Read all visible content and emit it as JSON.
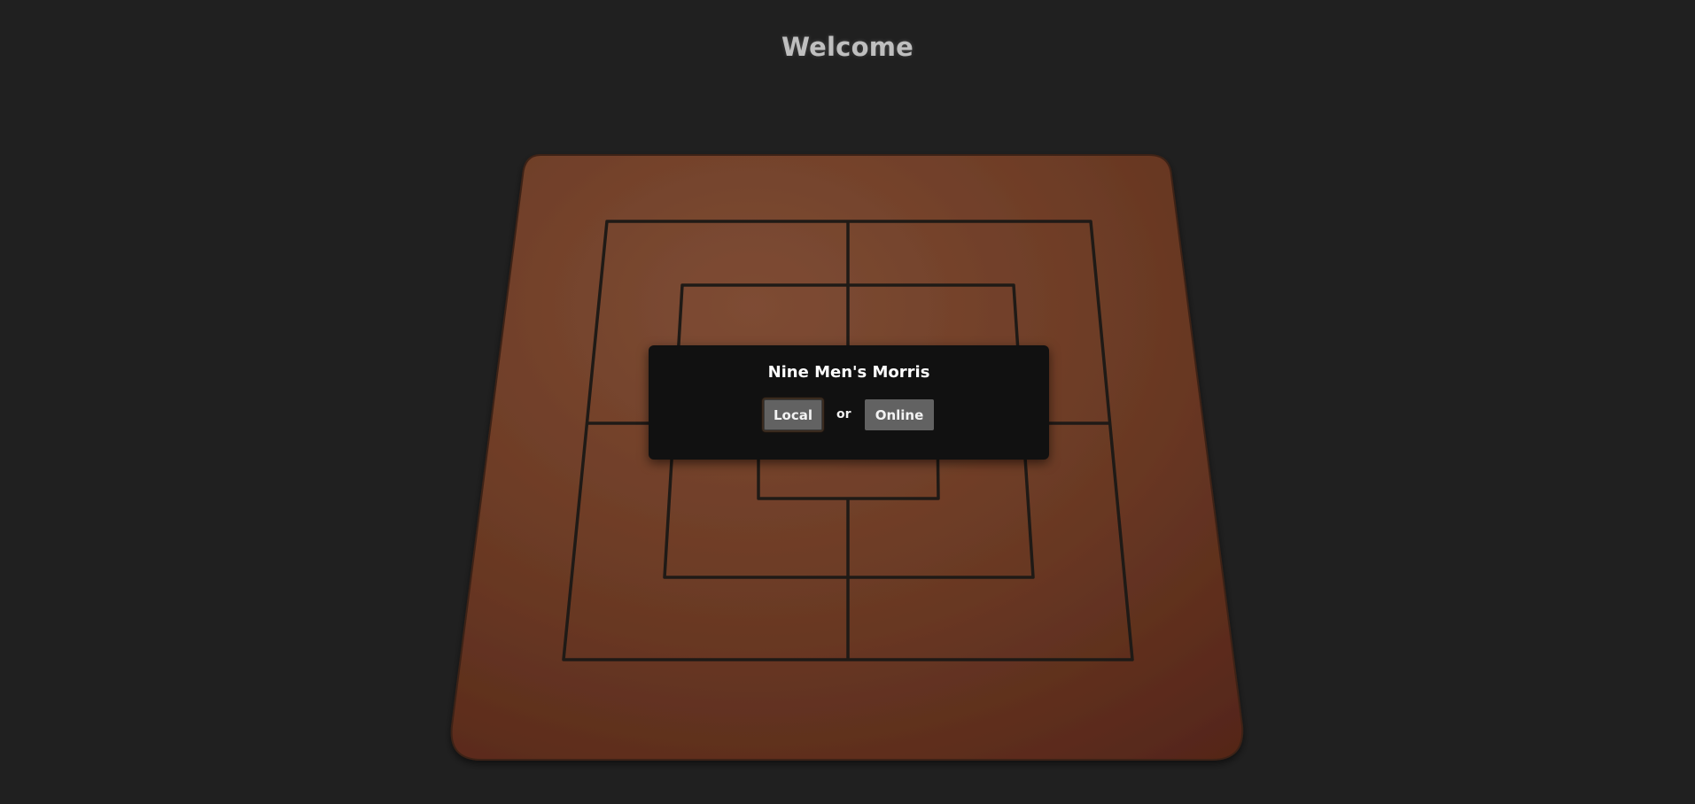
{
  "page": {
    "heading": "Welcome"
  },
  "board": {
    "game": "Nine Men's Morris",
    "color": "#6f3a25",
    "line_color": "#1f1a16"
  },
  "dialog": {
    "title": "Nine Men's Morris",
    "local_label": "Local",
    "separator": "or",
    "online_label": "Online"
  }
}
